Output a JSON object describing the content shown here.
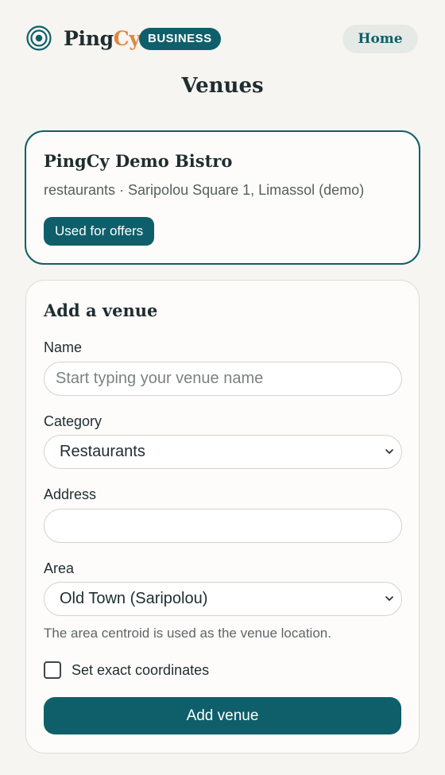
{
  "header": {
    "brand_part1": "Ping",
    "brand_part2": "Cy",
    "badge": "BUSINESS",
    "home_label": "Home",
    "logo_icon": "concentric-rings-icon"
  },
  "page": {
    "title": "Venues"
  },
  "venues": [
    {
      "name": "PingCy Demo Bistro",
      "meta": "restaurants · Saripolou Square 1, Limassol (demo)",
      "badge": "Used for offers"
    }
  ],
  "form": {
    "title": "Add a venue",
    "name_label": "Name",
    "name_placeholder": "Start typing your venue name",
    "name_value": "",
    "category_label": "Category",
    "category_value": "Restaurants",
    "address_label": "Address",
    "address_value": "",
    "area_label": "Area",
    "area_value": "Old Town (Saripolou)",
    "hint": "The area centroid is used as the venue location.",
    "exact_coords_label": "Set exact coordinates",
    "exact_coords_checked": false,
    "submit_label": "Add venue"
  },
  "colors": {
    "accent": "#0f5f6a",
    "brand_orange": "#e0873f",
    "background": "#f7f5f1"
  }
}
